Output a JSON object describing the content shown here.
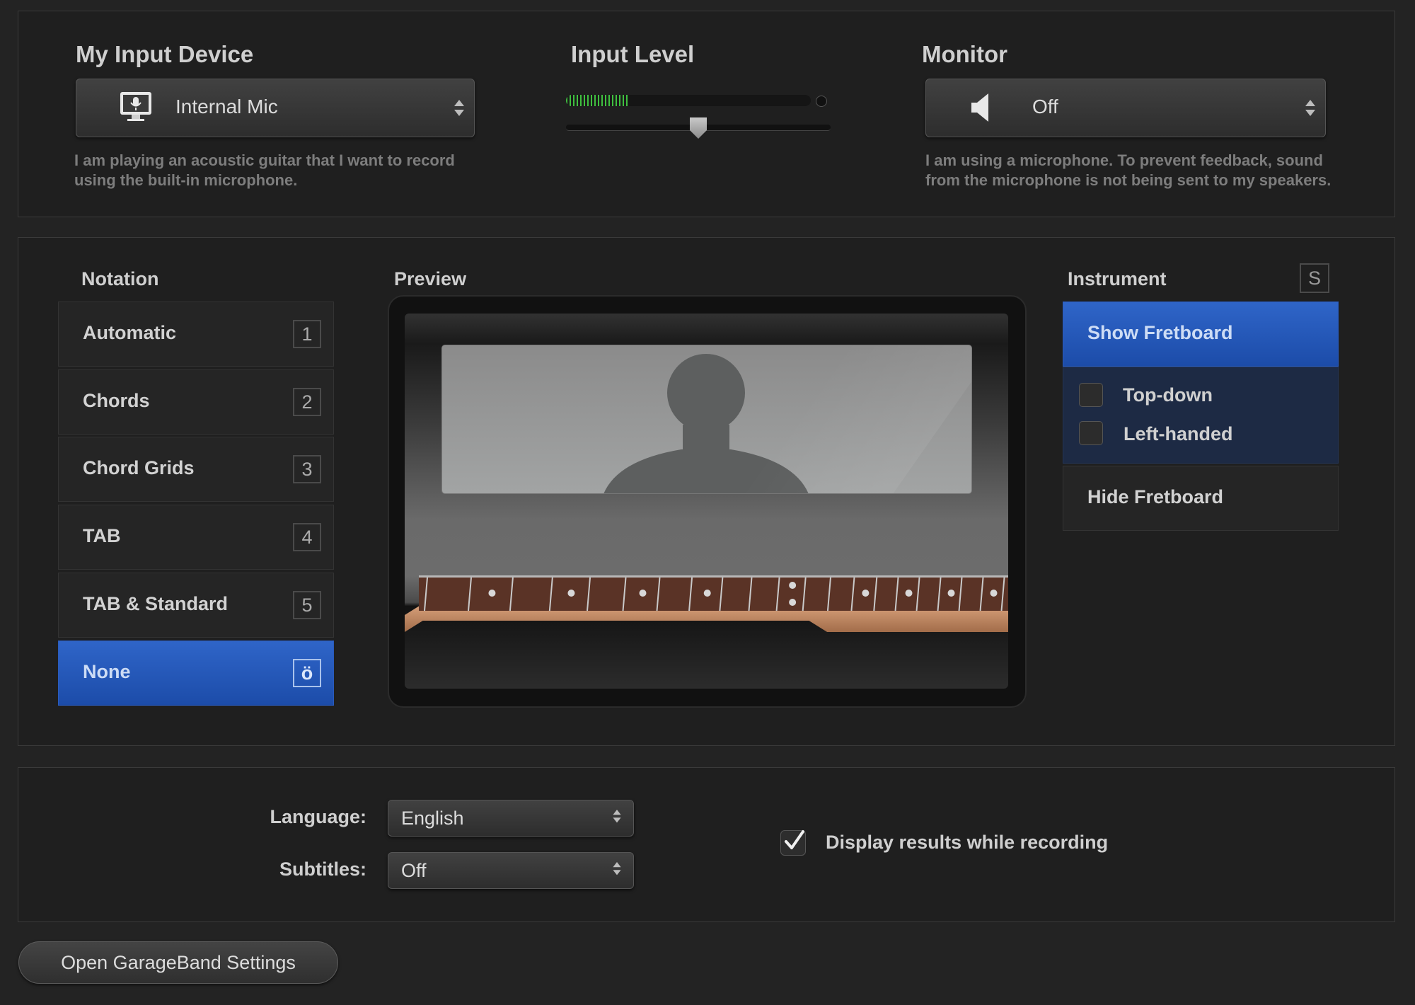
{
  "input_device": {
    "heading": "My Input Device",
    "selected": "Internal Mic",
    "icon": "computer-mic-icon",
    "description": "I am playing an acoustic guitar that I want to record using the built-in microphone."
  },
  "input_level": {
    "heading": "Input Level",
    "meter_level": 0.25,
    "slider_value": 0.5
  },
  "monitor": {
    "heading": "Monitor",
    "selected": "Off",
    "icon": "speaker-icon",
    "description": "I am using a microphone. To prevent feedback, sound from the microphone is not being sent to my speakers."
  },
  "notation": {
    "heading": "Notation",
    "items": [
      {
        "label": "Automatic",
        "key": "1",
        "selected": false
      },
      {
        "label": "Chords",
        "key": "2",
        "selected": false
      },
      {
        "label": "Chord Grids",
        "key": "3",
        "selected": false
      },
      {
        "label": "TAB",
        "key": "4",
        "selected": false
      },
      {
        "label": "TAB & Standard",
        "key": "5",
        "selected": false
      },
      {
        "label": "None",
        "key": "ö",
        "selected": true
      }
    ]
  },
  "preview": {
    "heading": "Preview"
  },
  "instrument": {
    "heading": "Instrument",
    "key": "S",
    "show_fretboard": "Show Fretboard",
    "top_down": "Top-down",
    "left_handed": "Left-handed",
    "hide_fretboard": "Hide Fretboard"
  },
  "settings": {
    "language_label": "Language:",
    "language_value": "English",
    "subtitles_label": "Subtitles:",
    "subtitles_value": "Off",
    "display_results": "Display results while recording",
    "display_results_checked": true,
    "open_settings": "Open GarageBand Settings"
  },
  "colors": {
    "accent_blue": "#2a5bbd",
    "meter_green": "#3fbf3f",
    "background": "#232323"
  }
}
